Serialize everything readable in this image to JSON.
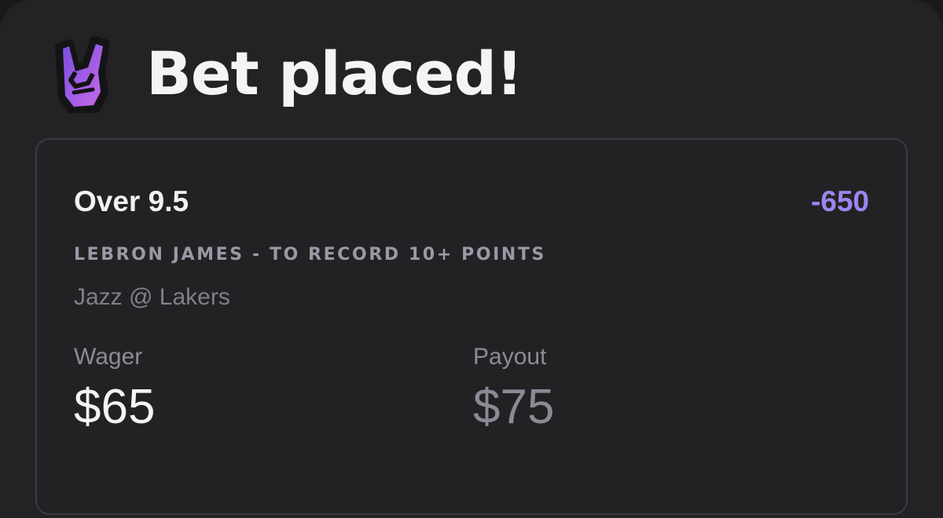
{
  "header": {
    "logo_icon": "rock-hand-icon",
    "title": "Bet placed!"
  },
  "bet": {
    "selection": "Over 9.5",
    "odds": "-650",
    "market": "LEBRON JAMES - TO RECORD 10+ POINTS",
    "matchup": "Jazz @ Lakers",
    "wager_label": "Wager",
    "wager_value": "$65",
    "payout_label": "Payout",
    "payout_value": "$75"
  },
  "colors": {
    "background": "#232325",
    "accent_odds": "#9c85f0",
    "logo_gradient_start": "#7b4de0",
    "logo_gradient_end": "#c46be8"
  }
}
